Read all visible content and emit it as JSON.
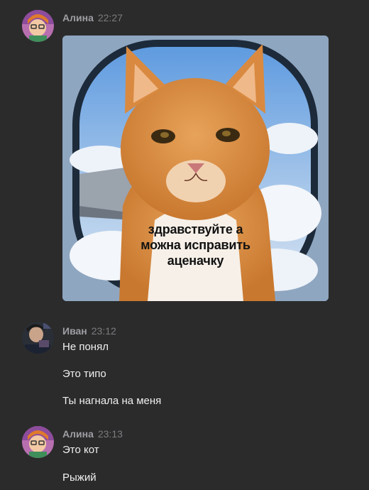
{
  "messages": [
    {
      "author": "Алина",
      "time": "22:27",
      "image": {
        "caption_lines": [
          "здравствуйте а",
          "можна исправить",
          "аценачку"
        ]
      }
    },
    {
      "author": "Иван",
      "time": "23:12",
      "lines": [
        "Не понял",
        "Это типо",
        "Ты нагнала на меня"
      ]
    },
    {
      "author": "Алина",
      "time": "23:13",
      "lines": [
        "Это кот",
        "Рыжий"
      ]
    }
  ],
  "colors": {
    "background": "#2b2b2c",
    "author_name": "#9e9ea3",
    "timestamp": "#7c7c80",
    "message_text": "#f0f0f0"
  }
}
